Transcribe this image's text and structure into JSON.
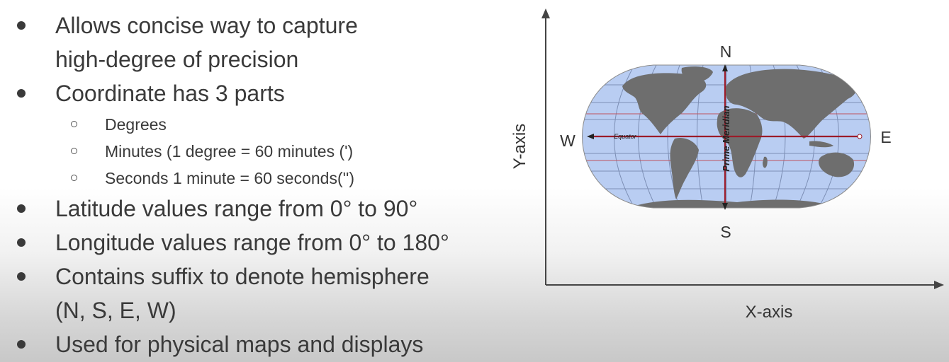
{
  "bullets": [
    {
      "text": "Allows concise way to capture"
    },
    {
      "text": "high-degree of precision"
    },
    {
      "text": "Coordinate has 3 parts"
    },
    {
      "text": "Degrees"
    },
    {
      "text": "Minutes (1 degree = 60 minutes (')"
    },
    {
      "text": "Seconds 1 minute = 60 seconds('')"
    },
    {
      "text": "Latitude values range from 0° to 90°"
    },
    {
      "text": "Longitude values range from 0° to 180°"
    },
    {
      "text": "Contains suffix to denote hemisphere"
    },
    {
      "text": "(N, S, E, W)"
    },
    {
      "text": "Used for physical maps and displays"
    }
  ],
  "diagram": {
    "y_axis_label": "Y-axis",
    "x_axis_label": "X-axis",
    "north": "N",
    "south": "S",
    "east": "E",
    "west": "W",
    "equator_label": "Equator",
    "meridian_label": "Prime Meridian",
    "colors": {
      "ocean": "#b9cdf2",
      "land": "#6e6e6e",
      "grid": "#7d8fb5",
      "line": "#9b1c2a"
    }
  }
}
